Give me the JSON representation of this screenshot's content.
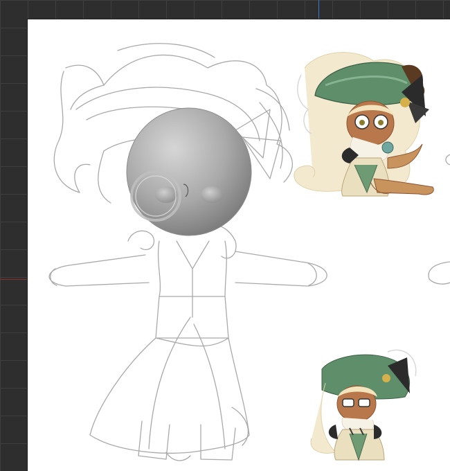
{
  "app": {
    "accent_guide_color": "#3b78c9",
    "canvas_color": "#ffffff",
    "workspace_color": "#2e2e2e"
  },
  "icons": {
    "model": "3d-head-sphere-icon",
    "reference_large": "character-reference-icon",
    "reference_small": "character-reference-icon"
  }
}
